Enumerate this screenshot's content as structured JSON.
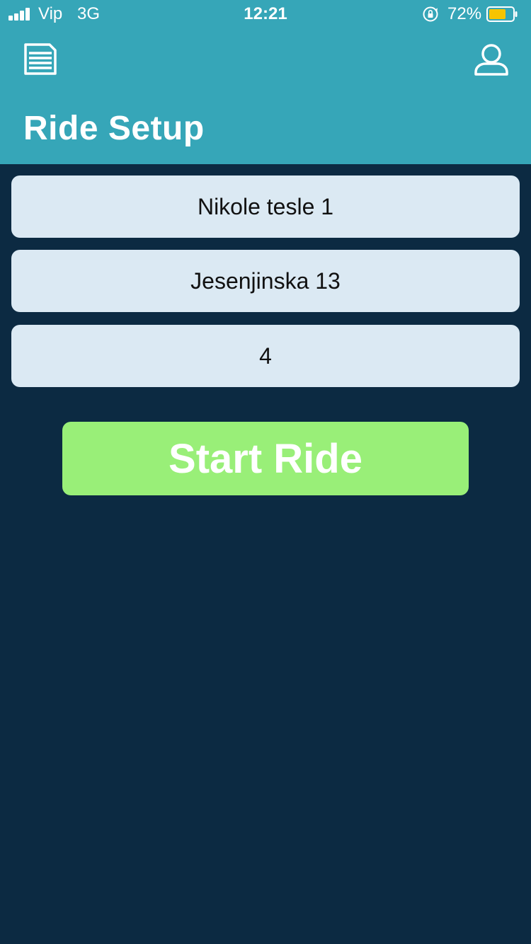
{
  "status_bar": {
    "carrier": "Vip",
    "network": "3G",
    "time": "12:21",
    "battery_percent": "72%",
    "battery_level": 0.72,
    "signal_bars": 4,
    "icons": [
      "signal-icon",
      "orientation-lock-icon",
      "battery-icon"
    ]
  },
  "nav": {
    "menu_icon": "document-list-icon",
    "profile_icon": "user-icon"
  },
  "page": {
    "title": "Ride Setup"
  },
  "form": {
    "start_location": "Nikole tesle 1",
    "destination": "Jesenjinska 13",
    "passengers": "4",
    "submit_label": "Start Ride"
  },
  "colors": {
    "header_bg": "#36a6b8",
    "page_bg": "#0c2a42",
    "field_bg": "#dbe9f3",
    "button_bg": "#99ef78",
    "battery_fill": "#f6c400"
  }
}
